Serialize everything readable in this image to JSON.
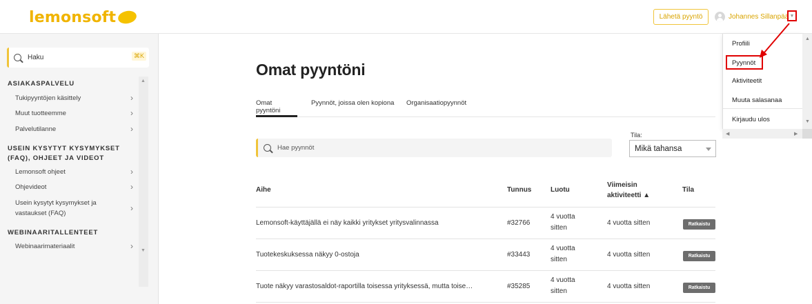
{
  "header": {
    "logo_text": "lemonsoft",
    "send_button": "Lähetä pyyntö",
    "user_name": "Johannes Sillanpää",
    "caret_icon": "chevron-down-icon"
  },
  "sidebar": {
    "search_placeholder": "Haku",
    "search_shortcut": "⌘K",
    "sections": [
      {
        "title": "ASIAKASPALVELU",
        "items": [
          "Tukipyyntöjen käsittely",
          "Muut tuotteemme",
          "Palvelutilanne"
        ]
      },
      {
        "title_line1": "USEIN KYSYTYT KYSYMYKSET",
        "title_line2": "(FAQ), OHJEET JA VIDEOT",
        "items": [
          "Lemonsoft ohjeet",
          "Ohjevideot",
          "Usein kysytyt kysymykset ja",
          "vastaukset (FAQ)"
        ]
      },
      {
        "title": "WEBINAARITALLENTEET",
        "items": [
          "Webinaarimateriaalit"
        ]
      }
    ]
  },
  "main": {
    "title": "Omat pyyntöni",
    "tabs": [
      "Omat pyyntöni",
      "Pyynnöt, joissa olen kopiona",
      "Organisaatiopyynnöt"
    ],
    "search_placeholder": "Hae pyynnöt",
    "filter_label": "Tila:",
    "filter_value": "Mikä tahansa",
    "table": {
      "headers": {
        "subject": "Aihe",
        "id": "Tunnus",
        "created": "Luotu",
        "activity_1": "Viimeisin",
        "activity_2": "aktiviteetti ▲",
        "status": "Tila"
      },
      "rows": [
        {
          "subject": "Lemonsoft-käyttäjällä ei näy kaikki yritykset yritysvalinnassa",
          "id": "#32766",
          "created_1": "4 vuotta",
          "created_2": "sitten",
          "activity": "4 vuotta sitten",
          "status": "Ratkaistu"
        },
        {
          "subject": "Tuotekeskuksessa näkyy 0-ostoja",
          "id": "#33443",
          "created_1": "4 vuotta",
          "created_2": "sitten",
          "activity": "4 vuotta sitten",
          "status": "Ratkaistu"
        },
        {
          "subject": "Tuote näkyy varastosaldot-raportilla toisessa yrityksessä, mutta toise…",
          "id": "#35285",
          "created_1": "4 vuotta",
          "created_2": "sitten",
          "activity": "4 vuotta sitten",
          "status": "Ratkaistu"
        }
      ]
    }
  },
  "user_menu": {
    "items": [
      "Profiili",
      "Pyynnöt",
      "Aktiviteetit",
      "Muuta salasanaa",
      "Kirjaudu ulos"
    ],
    "highlighted": "Pyynnöt"
  },
  "colors": {
    "brand": "#f0b400",
    "accent_border": "#f0c43a",
    "annotation": "#e00000",
    "badge": "#6d6d6d"
  }
}
